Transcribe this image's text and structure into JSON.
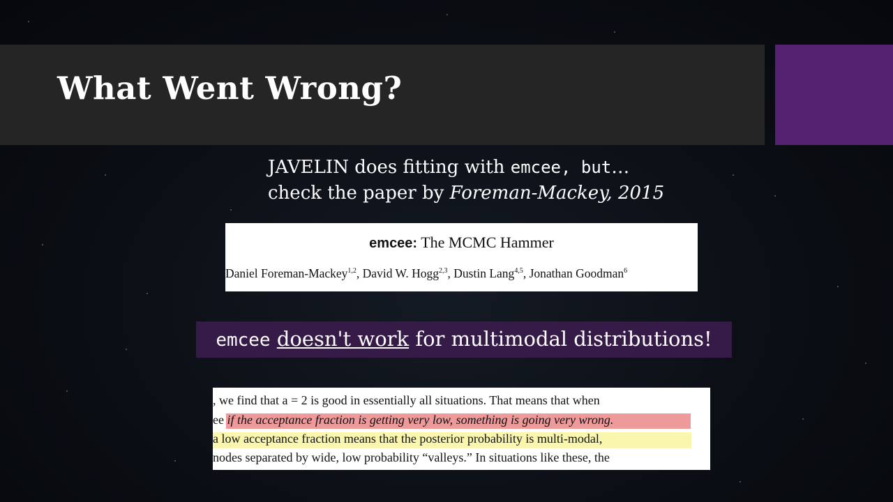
{
  "slide": {
    "title": "What Went Wrong?",
    "colors": {
      "title_band": "#252525",
      "accent_block": "#542270",
      "callout_bg": "#361a48",
      "highlight_red": "#ef9a9a",
      "highlight_yellow": "#fbf6ae"
    }
  },
  "intro": {
    "line1_prefix": "JAVELIN does fitting with ",
    "line1_code": "emcee, but",
    "line1_suffix": "…",
    "line2_prefix": "check the paper by ",
    "line2_citation": "Foreman-Mackey, 2015"
  },
  "paper_header": {
    "title_sans": "emcee:",
    "title_serif": " The MCMC Hammer",
    "authors": [
      {
        "name": "Daniel Foreman-Mackey",
        "sup": "1,2",
        "sep": ", "
      },
      {
        "name": "David W. Hogg",
        "sup": "2,3",
        "sep": ", "
      },
      {
        "name": "Dustin Lang",
        "sup": "4,5",
        "sep": ", "
      },
      {
        "name": "Jonathan Goodman",
        "sup": "6",
        "sep": ""
      }
    ]
  },
  "callout": {
    "code": "emcee",
    "underlined": "doesn't work",
    "rest": " for multimodal distributions!"
  },
  "excerpt": {
    "line1": ", we find that a = 2 is good in essentially all situations.  That means that when",
    "line2_prefix": "ee ",
    "line2_highlight": "if the acceptance fraction is getting very low, something is going very wrong.",
    "line3": "a low acceptance fraction means that the posterior probability is multi-modal,",
    "line4": "nodes separated by wide, low probability “valleys.”  In situations like these, the"
  }
}
